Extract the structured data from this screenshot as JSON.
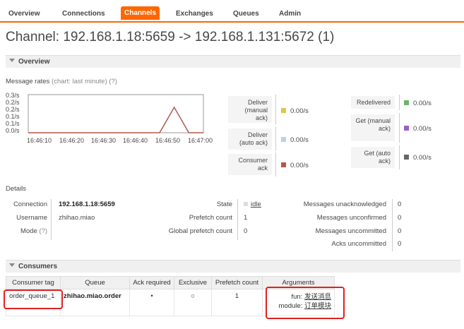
{
  "nav": {
    "items": [
      "Overview",
      "Connections",
      "Channels",
      "Exchanges",
      "Queues",
      "Admin"
    ],
    "active": "Channels"
  },
  "page_title": "Channel: 192.168.1.18:5659 -> 192.168.1.131:5672 (1)",
  "overview": {
    "heading": "Overview",
    "message_rates": "Message rates",
    "chart_note": "(chart: last minute)",
    "help": "(?)"
  },
  "chart_data": {
    "type": "line",
    "y_ticks": [
      "0.3/s",
      "0.2/s",
      "0.2/s",
      "0.1/s",
      "0.1/s",
      "0.0/s"
    ],
    "x_ticks": [
      "16:46:10",
      "16:46:20",
      "16:46:30",
      "16:46:40",
      "16:46:50",
      "16:47:00"
    ],
    "series": [
      {
        "color": "#b05a4a",
        "x": [
          "16:46:00",
          "16:46:10",
          "16:46:20",
          "16:46:30",
          "16:46:40",
          "16:46:45",
          "16:46:50",
          "16:46:55",
          "16:47:00"
        ],
        "y": [
          0,
          0,
          0,
          0,
          0,
          0,
          0.2,
          0,
          0
        ]
      }
    ],
    "ylim": [
      0,
      0.3
    ]
  },
  "rates": {
    "deliver_manual": {
      "label": "Deliver (manual ack)",
      "value": "0.00/s",
      "color": "#e6c34a"
    },
    "deliver_auto": {
      "label": "Deliver (auto ack)",
      "value": "0.00/s",
      "color": "#b7d3ef"
    },
    "consumer_ack": {
      "label": "Consumer ack",
      "value": "0.00/s",
      "color": "#b05a4a"
    },
    "redelivered": {
      "label": "Redelivered",
      "value": "0.00/s",
      "color": "#6db36d"
    },
    "get_manual": {
      "label": "Get (manual ack)",
      "value": "0.00/s",
      "color": "#9a5fcb"
    },
    "get_auto": {
      "label": "Get (auto ack)",
      "value": "0.00/s",
      "color": "#666666"
    }
  },
  "details": {
    "label": "Details",
    "connection_label": "Connection",
    "connection_value": "192.168.1.18:5659",
    "username_label": "Username",
    "username_value": "zhihao.miao",
    "mode_label": "Mode",
    "mode_help": "(?)",
    "state_label": "State",
    "state_value": "idle",
    "prefetch_label": "Prefetch count",
    "prefetch_value": "1",
    "global_prefetch_label": "Global prefetch count",
    "global_prefetch_value": "0",
    "unack_label": "Messages unacknowledged",
    "unack_value": "0",
    "unconfirmed_label": "Messages unconfirmed",
    "unconfirmed_value": "0",
    "uncommitted_label": "Messages uncommitted",
    "uncommitted_value": "0",
    "acks_uncommitted_label": "Acks uncommitted",
    "acks_uncommitted_value": "0"
  },
  "consumers": {
    "heading": "Consumers",
    "columns": [
      "Consumer tag",
      "Queue",
      "Ack required",
      "Exclusive",
      "Prefetch count",
      "Arguments"
    ],
    "row": {
      "tag": "order_queue_1",
      "queue": "zhihao.miao.order",
      "ack_required": "•",
      "exclusive": "○",
      "prefetch": "1",
      "args": [
        {
          "key": "fun:",
          "value": "发送消息"
        },
        {
          "key": "module:",
          "value": "订单模块"
        }
      ]
    }
  }
}
